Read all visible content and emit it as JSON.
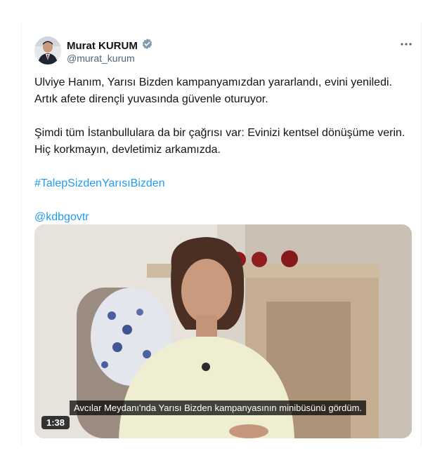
{
  "tweet": {
    "author": {
      "name": "Murat KURUM",
      "handle": "@murat_kurum",
      "verified": true
    },
    "paragraphs": [
      "Ulviye Hanım, Yarısı Bizden kampanyamızdan yararlandı, evini yeniledi. Artık afete dirençli yuvasında güvenle oturuyor.",
      "Şimdi tüm İstanbullulara da bir çağrısı var: Evinizi kentsel dönüşüme verin. Hiç korkmayın, devletimiz arkamızda."
    ],
    "hashtag": "#TalepSizdenYarısıBizden",
    "mention": "@kdbgovtr",
    "more_icon": "more-horizontal-icon",
    "link_color": "#1d9bf0",
    "verified_color": "#829aab"
  },
  "video": {
    "caption": "Avcılar Meydanı'nda Yarısı Bizden kampanyasının minibüsünü gördüm.",
    "duration": "1:38"
  }
}
